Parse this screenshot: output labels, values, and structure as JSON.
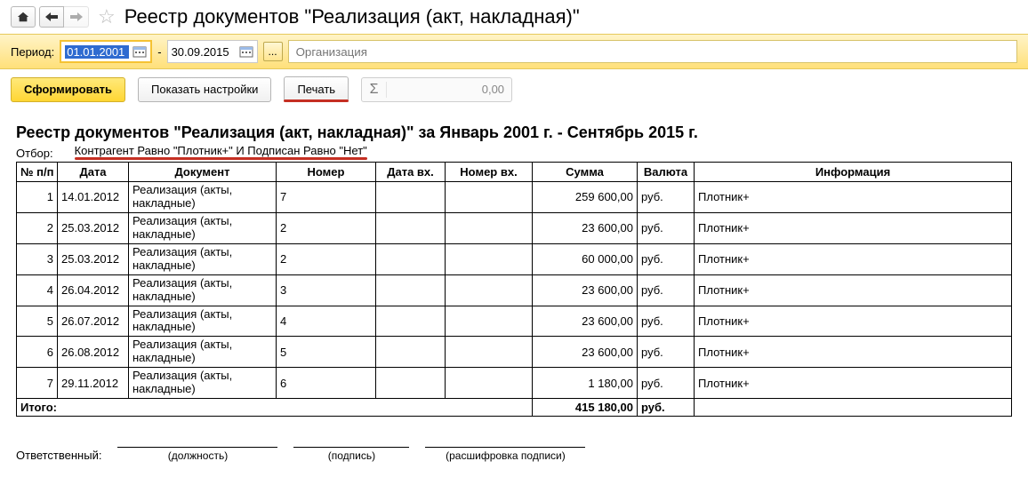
{
  "header": {
    "page_title": "Реестр документов \"Реализация (акт, накладная)\""
  },
  "filterbar": {
    "period_label": "Период:",
    "date_from": "01.01.2001",
    "date_to": "30.09.2015",
    "org_placeholder": "Организация",
    "more_label": "..."
  },
  "actions": {
    "generate": "Сформировать",
    "show_settings": "Показать настройки",
    "print": "Печать",
    "sigma_value": "0,00"
  },
  "report": {
    "title": "Реестр документов \"Реализация (акт, накладная)\"  за Январь 2001 г. - Сентябрь 2015 г.",
    "filter_label": "Отбор:",
    "filter_value": "Контрагент Равно \"Плотник+\" И Подписан Равно \"Нет\"",
    "columns": {
      "num": "№ п/п",
      "date": "Дата",
      "doc": "Документ",
      "nomer": "Номер",
      "date_in": "Дата вх.",
      "num_in": "Номер вх.",
      "sum": "Сумма",
      "currency": "Валюта",
      "info": "Информация"
    },
    "rows": [
      {
        "n": "1",
        "date": "14.01.2012",
        "doc": "Реализация (акты, накладные)",
        "num": "7",
        "sum": "259 600,00",
        "cur": "руб.",
        "info": "Плотник+"
      },
      {
        "n": "2",
        "date": "25.03.2012",
        "doc": "Реализация (акты, накладные)",
        "num": "2",
        "sum": "23 600,00",
        "cur": "руб.",
        "info": "Плотник+"
      },
      {
        "n": "3",
        "date": "25.03.2012",
        "doc": "Реализация (акты, накладные)",
        "num": "2",
        "sum": "60 000,00",
        "cur": "руб.",
        "info": "Плотник+"
      },
      {
        "n": "4",
        "date": "26.04.2012",
        "doc": "Реализация (акты, накладные)",
        "num": "3",
        "sum": "23 600,00",
        "cur": "руб.",
        "info": "Плотник+"
      },
      {
        "n": "5",
        "date": "26.07.2012",
        "doc": "Реализация (акты, накладные)",
        "num": "4",
        "sum": "23 600,00",
        "cur": "руб.",
        "info": "Плотник+"
      },
      {
        "n": "6",
        "date": "26.08.2012",
        "doc": "Реализация (акты, накладные)",
        "num": "5",
        "sum": "23 600,00",
        "cur": "руб.",
        "info": "Плотник+"
      },
      {
        "n": "7",
        "date": "29.11.2012",
        "doc": "Реализация (акты, накладные)",
        "num": "6",
        "sum": "1 180,00",
        "cur": "руб.",
        "info": "Плотник+"
      }
    ],
    "total": {
      "label": "Итого:",
      "sum": "415 180,00",
      "cur": "руб."
    },
    "signatures": {
      "responsible": "Ответственный:",
      "position": "(должность)",
      "signature": "(подпись)",
      "decipher": "(расшифровка подписи)"
    }
  }
}
